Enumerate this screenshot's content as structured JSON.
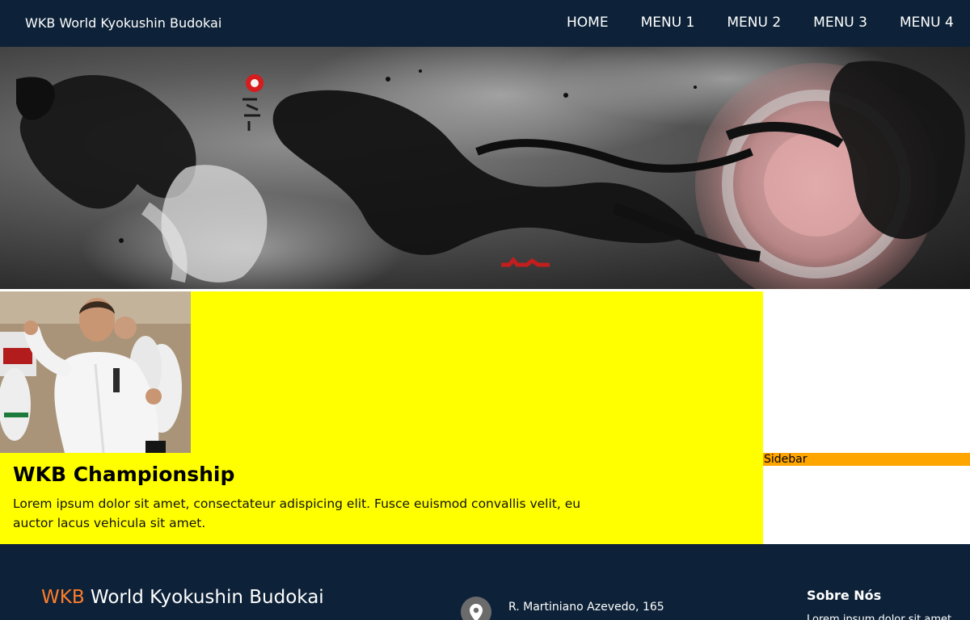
{
  "header": {
    "brand": "WKB World Kyokushin Budokai",
    "nav": [
      {
        "label": "HOME"
      },
      {
        "label": "MENU 1"
      },
      {
        "label": "MENU 2"
      },
      {
        "label": "MENU 3"
      },
      {
        "label": "MENU 4"
      }
    ]
  },
  "hero": {
    "image": "karate-fighters-ink-banner"
  },
  "main": {
    "card": {
      "image": "karate-instructor-photo",
      "title": "WKB Championship",
      "text": "Lorem ipsum dolor sit amet, consectateur adispicing elit. Fusce euismod convallis velit, eu auctor lacus vehicula sit amet."
    }
  },
  "sidebar": {
    "label": "Sidebar"
  },
  "footer": {
    "brand_accent": "WKB",
    "brand_rest": " World Kyokushin Budokai",
    "address_icon": "location-pin-icon",
    "address": "R. Martiniano Azevedo, 165",
    "about_title": "Sobre Nós",
    "about_text": "Lorem ipsum dolor sit amet"
  },
  "colors": {
    "nav_bg": "#0d2238",
    "content_bg": "#ffff00",
    "sidebar_label_bg": "#ffa500",
    "footer_accent": "#ff7d2a"
  }
}
